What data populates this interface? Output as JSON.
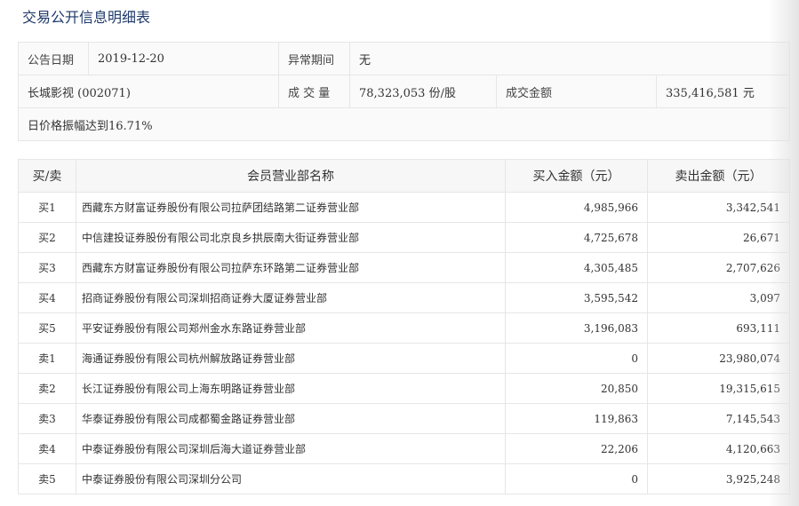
{
  "title": "交易公开信息明细表",
  "info": {
    "date_label": "公告日期",
    "date_value": "2019-12-20",
    "abnormal_label": "异常期间",
    "abnormal_value": "无",
    "stock": "长城影视 (002071)",
    "volume_label": "成 交 量",
    "volume_value": "78,323,053 份/股",
    "amount_label": "成交金额",
    "amount_value": "335,416,581 元",
    "reason": "日价格振幅达到16.71%"
  },
  "table": {
    "headers": [
      "买/卖",
      "会员营业部名称",
      "买入金额（元）",
      "卖出金额（元）"
    ],
    "rows": [
      {
        "side": "买1",
        "name": "西藏东方财富证券股份有限公司拉萨团结路第二证券营业部",
        "buy": "4,985,966",
        "sell": "3,342,541"
      },
      {
        "side": "买2",
        "name": "中信建投证券股份有限公司北京良乡拱辰南大街证券营业部",
        "buy": "4,725,678",
        "sell": "26,671"
      },
      {
        "side": "买3",
        "name": "西藏东方财富证券股份有限公司拉萨东环路第二证券营业部",
        "buy": "4,305,485",
        "sell": "2,707,626"
      },
      {
        "side": "买4",
        "name": "招商证券股份有限公司深圳招商证券大厦证券营业部",
        "buy": "3,595,542",
        "sell": "3,097"
      },
      {
        "side": "买5",
        "name": "平安证券股份有限公司郑州金水东路证券营业部",
        "buy": "3,196,083",
        "sell": "693,111"
      },
      {
        "side": "卖1",
        "name": "海通证券股份有限公司杭州解放路证券营业部",
        "buy": "0",
        "sell": "23,980,074"
      },
      {
        "side": "卖2",
        "name": "长江证券股份有限公司上海东明路证券营业部",
        "buy": "20,850",
        "sell": "19,315,615"
      },
      {
        "side": "卖3",
        "name": "华泰证券股份有限公司成都蜀金路证券营业部",
        "buy": "119,863",
        "sell": "7,145,543"
      },
      {
        "side": "卖4",
        "name": "中泰证券股份有限公司深圳后海大道证券营业部",
        "buy": "22,206",
        "sell": "4,120,663"
      },
      {
        "side": "卖5",
        "name": "中泰证券股份有限公司深圳分公司",
        "buy": "0",
        "sell": "3,925,248"
      }
    ]
  }
}
